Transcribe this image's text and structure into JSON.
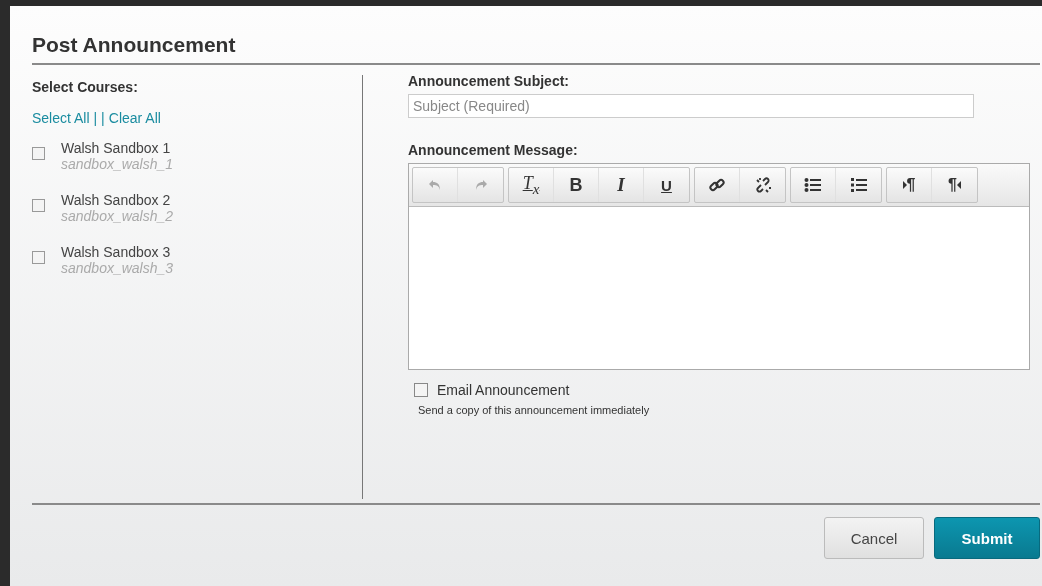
{
  "dialog": {
    "title": "Post Announcement"
  },
  "courses": {
    "heading": "Select Courses:",
    "select_all": "Select All",
    "separator": "| |",
    "clear_all": "Clear All",
    "items": [
      {
        "name": "Walsh Sandbox 1",
        "code": "sandbox_walsh_1",
        "checked": false
      },
      {
        "name": "Walsh Sandbox 2",
        "code": "sandbox_walsh_2",
        "checked": false
      },
      {
        "name": "Walsh Sandbox 3",
        "code": "sandbox_walsh_3",
        "checked": false
      }
    ]
  },
  "subject": {
    "label": "Announcement Subject:",
    "placeholder": "Subject (Required)"
  },
  "message": {
    "label": "Announcement Message:",
    "toolbar": [
      [
        {
          "kind": "undo",
          "disabled": true
        },
        {
          "kind": "redo",
          "disabled": true
        }
      ],
      [
        {
          "kind": "clear-format",
          "label": "T$_{x}$",
          "disabled": false
        },
        {
          "kind": "bold",
          "label": "B",
          "disabled": false
        },
        {
          "kind": "italic",
          "label": "I",
          "disabled": false
        },
        {
          "kind": "underline",
          "label": "U",
          "disabled": false
        }
      ],
      [
        {
          "kind": "link",
          "disabled": false
        },
        {
          "kind": "unlink",
          "disabled": false
        }
      ],
      [
        {
          "kind": "bullet-list",
          "disabled": false
        },
        {
          "kind": "numbered-list",
          "disabled": false
        }
      ],
      [
        {
          "kind": "ltr",
          "label": "¶",
          "disabled": false
        },
        {
          "kind": "rtl",
          "label": "¶",
          "disabled": false
        }
      ]
    ]
  },
  "email": {
    "label": "Email Announcement",
    "checked": false,
    "hint": "Send a copy of this announcement immediately"
  },
  "buttons": [
    {
      "label": "Cancel",
      "kind": "secondary"
    },
    {
      "label": "Submit",
      "kind": "primary"
    }
  ]
}
